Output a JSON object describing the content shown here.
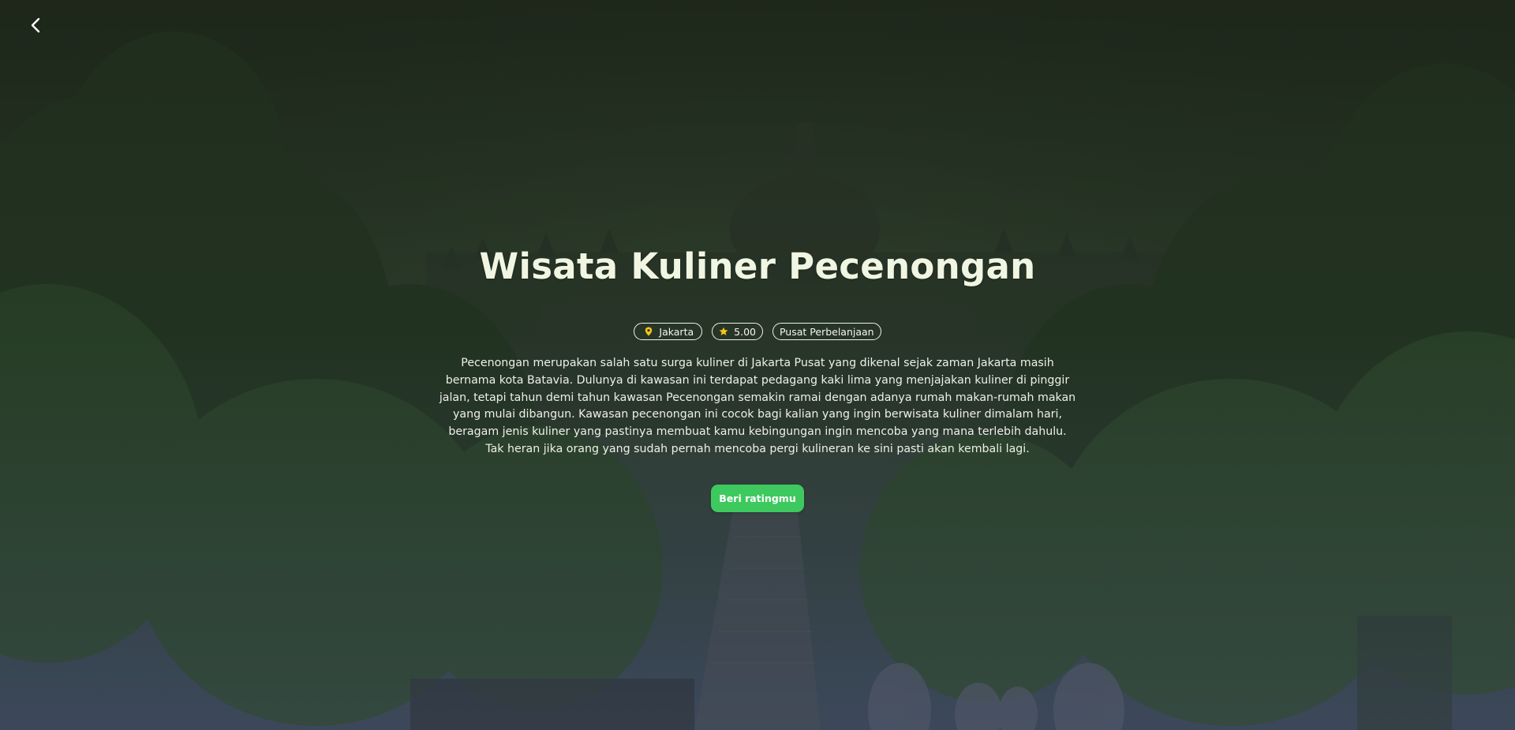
{
  "nav": {
    "back_icon": "chevron-left-icon"
  },
  "place": {
    "title": "Wisata Kuliner Pecenongan",
    "location": "Jakarta",
    "location_icon": "map-pin-icon",
    "rating": "5.00",
    "rating_icon": "star-icon",
    "category": "Pusat Perbelanjaan",
    "description": "Pecenongan merupakan salah satu surga kuliner di Jakarta Pusat yang dikenal sejak zaman Jakarta masih bernama kota Batavia. Dulunya di kawasan ini terdapat pedagang kaki lima yang menjajakan kuliner di pinggir jalan, tetapi tahun demi tahun kawasan Pecenongan semakin ramai dengan adanya rumah makan-rumah makan yang mulai dibangun. Kawasan pecenongan ini cocok bagi kalian yang ingin berwisata kuliner dimalam hari, beragam jenis kuliner yang pastinya membuat kamu kebingungan ingin mencoba yang mana terlebih dahulu. Tak heran jika orang yang sudah pernah mencoba pergi kulineran ke sini pasti akan kembali lagi."
  },
  "actions": {
    "rate_label": "Beri ratingmu"
  },
  "colors": {
    "accent": "#3ec95f",
    "title": "#f1f6e2",
    "pin": "#f5c518",
    "star": "#f5c518"
  }
}
